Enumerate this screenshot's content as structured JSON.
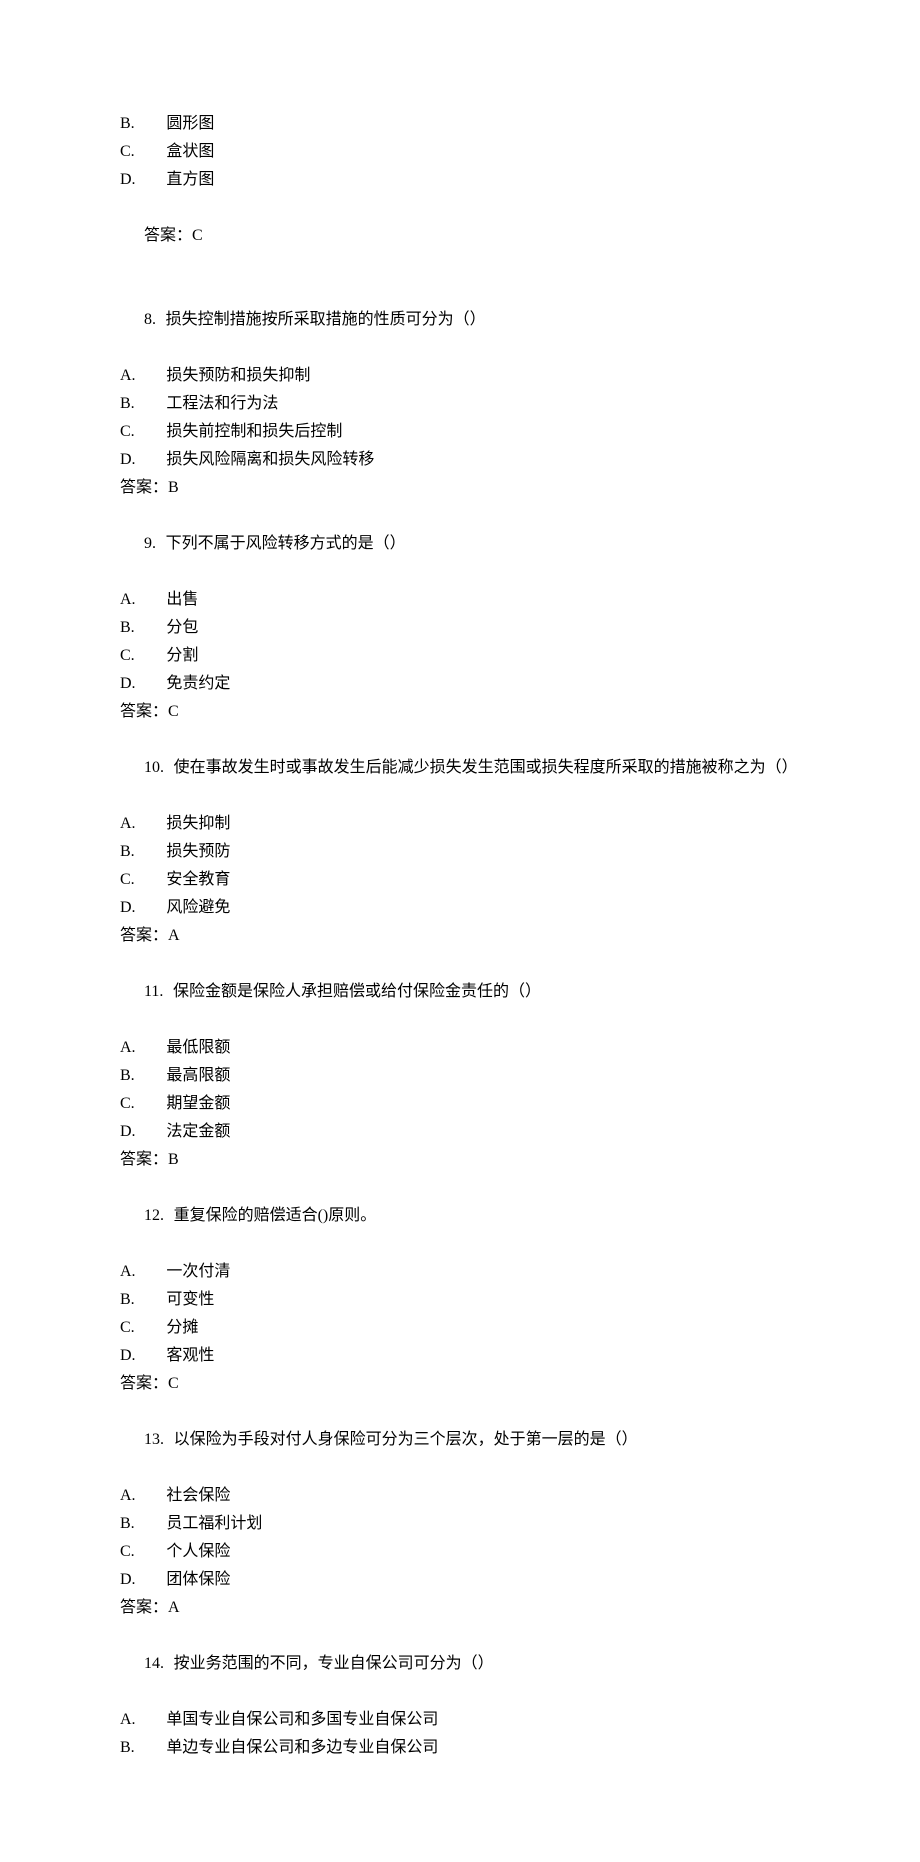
{
  "answer_label": "答案：",
  "orphan_options": [
    {
      "letter": "B.",
      "text": "圆形图"
    },
    {
      "letter": "C.",
      "text": "盒状图"
    },
    {
      "letter": "D.",
      "text": "直方图"
    }
  ],
  "orphan_answer": "C",
  "questions": [
    {
      "number": "8.",
      "stem": "损失控制措施按所采取措施的性质可分为（）",
      "options": [
        {
          "letter": "A.",
          "text": "损失预防和损失抑制"
        },
        {
          "letter": "B.",
          "text": "工程法和行为法"
        },
        {
          "letter": "C.",
          "text": "损失前控制和损失后控制"
        },
        {
          "letter": "D.",
          "text": "损失风险隔离和损失风险转移"
        }
      ],
      "answer": "B"
    },
    {
      "number": "9.",
      "stem": "下列不属于风险转移方式的是（）",
      "options": [
        {
          "letter": "A.",
          "text": "出售"
        },
        {
          "letter": "B.",
          "text": "分包"
        },
        {
          "letter": "C.",
          "text": "分割"
        },
        {
          "letter": "D.",
          "text": "免责约定"
        }
      ],
      "answer": "C"
    },
    {
      "number": "10.",
      "stem": "使在事故发生时或事故发生后能减少损失发生范围或损失程度所采取的措施被称之为（）",
      "options": [
        {
          "letter": "A.",
          "text": "损失抑制"
        },
        {
          "letter": "B.",
          "text": "损失预防"
        },
        {
          "letter": "C.",
          "text": "安全教育"
        },
        {
          "letter": "D.",
          "text": "风险避免"
        }
      ],
      "answer": "A"
    },
    {
      "number": "11.",
      "stem": "保险金额是保险人承担赔偿或给付保险金责任的（）",
      "options": [
        {
          "letter": "A.",
          "text": "最低限额"
        },
        {
          "letter": "B.",
          "text": "最高限额"
        },
        {
          "letter": "C.",
          "text": "期望金额"
        },
        {
          "letter": "D.",
          "text": "法定金额"
        }
      ],
      "answer": "B"
    },
    {
      "number": "12.",
      "stem": "重复保险的赔偿适合()原则。",
      "options": [
        {
          "letter": "A.",
          "text": "一次付清"
        },
        {
          "letter": "B.",
          "text": "可变性"
        },
        {
          "letter": "C.",
          "text": "分摊"
        },
        {
          "letter": "D.",
          "text": "客观性"
        }
      ],
      "answer": "C"
    },
    {
      "number": "13.",
      "stem": "以保险为手段对付人身保险可分为三个层次，处于第一层的是（）",
      "options": [
        {
          "letter": "A.",
          "text": "社会保险"
        },
        {
          "letter": "B.",
          "text": "员工福利计划"
        },
        {
          "letter": "C.",
          "text": "个人保险"
        },
        {
          "letter": "D.",
          "text": "团体保险"
        }
      ],
      "answer": "A"
    },
    {
      "number": "14.",
      "stem": "按业务范围的不同，专业自保公司可分为（）",
      "options": [
        {
          "letter": "A.",
          "text": "单国专业自保公司和多国专业自保公司"
        },
        {
          "letter": "B.",
          "text": "单边专业自保公司和多边专业自保公司"
        }
      ],
      "answer": null
    }
  ]
}
